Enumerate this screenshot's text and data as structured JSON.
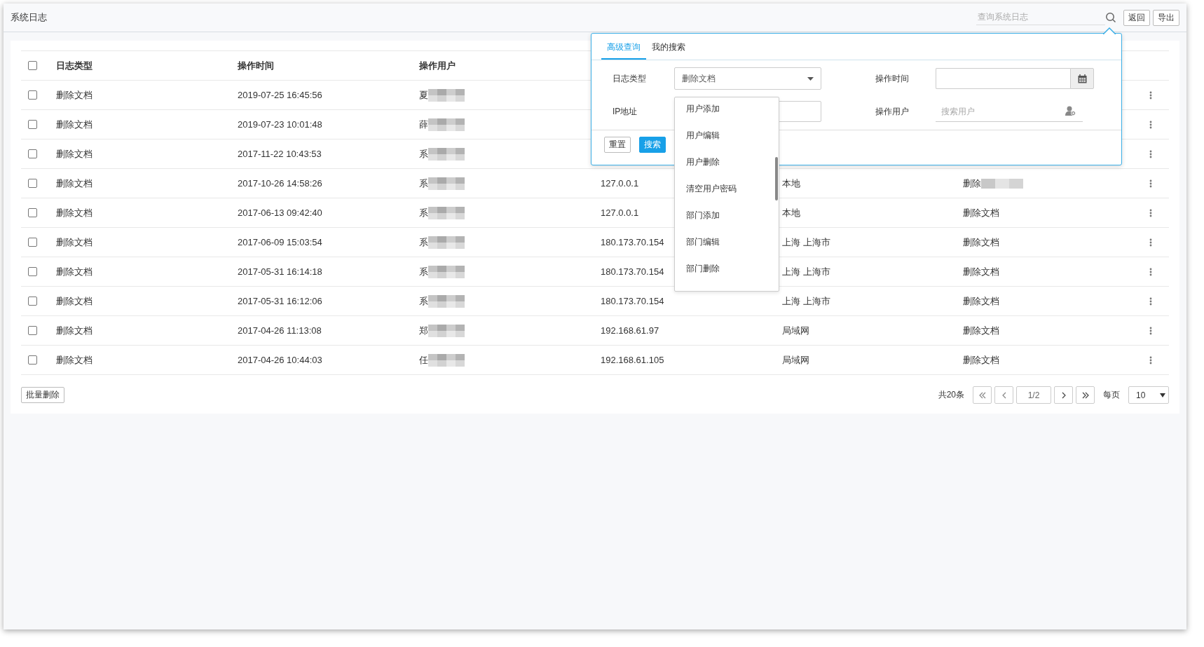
{
  "header": {
    "title": "系统日志",
    "search": {
      "placeholder": "查询系统日志"
    },
    "buttons": [
      "返回",
      "导出"
    ]
  },
  "table": {
    "select_all": {
      "checked": false
    },
    "columns": [
      "日志类型",
      "操作时间",
      "操作用户"
    ],
    "rows": [
      {
        "checked": false,
        "type": "删除文档",
        "time": "2019-07-25 16:45:56",
        "user": "夏",
        "user_blurred": true
      },
      {
        "checked": false,
        "type": "删除文档",
        "time": "2019-07-23 10:01:48",
        "user": "薛",
        "user_blurred": true
      },
      {
        "checked": false,
        "type": "删除文档",
        "time": "2017-11-22 10:43:53",
        "user": "系",
        "user_blurred": true
      },
      {
        "checked": false,
        "type": "删除文档",
        "time": "2017-10-26 14:58:26",
        "user": "系",
        "user_blurred": true,
        "ip": "127.0.0.1",
        "location": "本地",
        "description": "删除",
        "description_blurred": true
      },
      {
        "checked": false,
        "type": "删除文档",
        "time": "2017-06-13 09:42:40",
        "user": "系",
        "user_blurred": true,
        "ip": "127.0.0.1",
        "location": "本地",
        "description": "删除文档"
      },
      {
        "checked": false,
        "type": "删除文档",
        "time": "2017-06-09 15:03:54",
        "user": "系",
        "user_blurred": true,
        "ip": "180.173.70.154",
        "location": "上海 上海市",
        "description": "删除文档"
      },
      {
        "checked": false,
        "type": "删除文档",
        "time": "2017-05-31 16:14:18",
        "user": "系",
        "user_blurred": true,
        "ip": "180.173.70.154",
        "location": "上海 上海市",
        "description": "删除文档"
      },
      {
        "checked": false,
        "type": "删除文档",
        "time": "2017-05-31 16:12:06",
        "user": "系",
        "user_blurred": true,
        "ip": "180.173.70.154",
        "location": "上海 上海市",
        "description": "删除文档"
      },
      {
        "checked": false,
        "type": "删除文档",
        "time": "2017-04-26 11:13:08",
        "user": "郑",
        "user_blurred": true,
        "ip": "192.168.61.97",
        "location": "局域网",
        "description": "删除文档"
      },
      {
        "checked": false,
        "type": "删除文档",
        "time": "2017-04-26 10:44:03",
        "user": "任",
        "user_blurred": true,
        "ip": "192.168.61.105",
        "location": "局域网",
        "description": "删除文档"
      }
    ]
  },
  "batch_button": "批量删除",
  "pagination": {
    "total": "共20条",
    "page": "1/2",
    "per_page_label": "每页",
    "page_size": "10"
  },
  "search_panel": {
    "tabs": [
      {
        "label": "高级查询",
        "selected": true
      },
      {
        "label": "我的搜索",
        "selected": false
      }
    ],
    "log_type": {
      "label": "日志类型",
      "value": "删除文档",
      "expanded": true,
      "options": [
        "用户添加",
        "用户编辑",
        "用户删除",
        "清空用户密码",
        "部门添加",
        "部门编辑",
        "部门删除"
      ]
    },
    "ip": {
      "label": "IP地址"
    },
    "time": {
      "label": "操作时间"
    },
    "user": {
      "label": "操作用户",
      "placeholder": "搜索用户"
    },
    "buttons": [
      {
        "label": "重置",
        "kind": "default"
      },
      {
        "label": "搜索",
        "kind": "primary"
      }
    ]
  }
}
